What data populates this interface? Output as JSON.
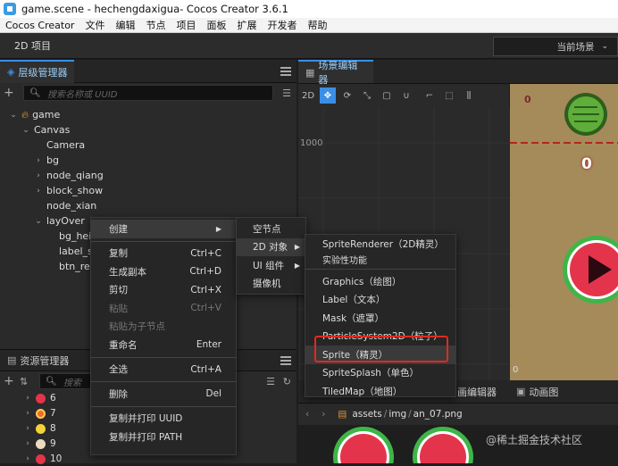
{
  "window": {
    "title": "game.scene - hechengdaxigua- Cocos Creator 3.6.1"
  },
  "menubar": [
    "Cocos Creator",
    "文件",
    "编辑",
    "节点",
    "项目",
    "面板",
    "扩展",
    "开发者",
    "帮助"
  ],
  "project": {
    "title": "2D 项目",
    "scene_select": "当前场景"
  },
  "hierarchy": {
    "tab": "层级管理器",
    "search_placeholder": "搜索名称或 UUID",
    "nodes": [
      "game",
      "Canvas",
      "Camera",
      "bg",
      "node_qiang",
      "block_show",
      "node_xian",
      "layOver",
      "bg_hei",
      "label_sc",
      "btn_reP"
    ]
  },
  "scene_editor": {
    "tab": "场景编辑器",
    "mode": "2D",
    "ruler_label": "1000"
  },
  "game_view": {
    "score": "0",
    "small_score": "0",
    "corner": "0"
  },
  "assets": {
    "tab": "资源管理器",
    "search_placeholder": "搜索",
    "items": [
      "6",
      "7",
      "8",
      "9",
      "10"
    ]
  },
  "bottom": {
    "tabs": [
      "画编辑器",
      "动画图"
    ],
    "path": [
      "assets",
      "img",
      "an_07.png"
    ]
  },
  "context_menu": {
    "items": [
      {
        "label": "创建",
        "shortcut": "",
        "arrow": true
      },
      {
        "label": "复制",
        "shortcut": "Ctrl+C"
      },
      {
        "label": "生成副本",
        "shortcut": "Ctrl+D"
      },
      {
        "label": "剪切",
        "shortcut": "Ctrl+X"
      },
      {
        "label": "粘贴",
        "shortcut": "Ctrl+V"
      },
      {
        "label": "粘贴为子节点",
        "shortcut": ""
      },
      {
        "label": "重命名",
        "shortcut": "Enter"
      },
      {
        "label": "全选",
        "shortcut": "Ctrl+A"
      },
      {
        "label": "删除",
        "shortcut": "Del"
      },
      {
        "label": "复制并打印 UUID",
        "shortcut": ""
      },
      {
        "label": "复制并打印 PATH",
        "shortcut": ""
      }
    ]
  },
  "create_submenu": [
    "空节点",
    "2D 对象",
    "UI 组件",
    "摄像机"
  ],
  "object2d_submenu": [
    {
      "label": "SpriteRenderer（2D精灵）",
      "sub": "实验性功能"
    },
    {
      "label": "Graphics（绘图）"
    },
    {
      "label": "Label（文本）"
    },
    {
      "label": "Mask（遮罩）"
    },
    {
      "label": "ParticleSystem2D（粒子）"
    },
    {
      "label": "Sprite（精灵）"
    },
    {
      "label": "SpriteSplash（单色）"
    },
    {
      "label": "TiledMap（地图）"
    }
  ],
  "watermark": "@稀土掘金技术社区",
  "colors": {
    "accent": "#3a8ee6",
    "highlight_box": "#e02a20",
    "game_bg": "#a58b5a",
    "melon_red": "#e4344c",
    "melon_green": "#3fb548"
  }
}
